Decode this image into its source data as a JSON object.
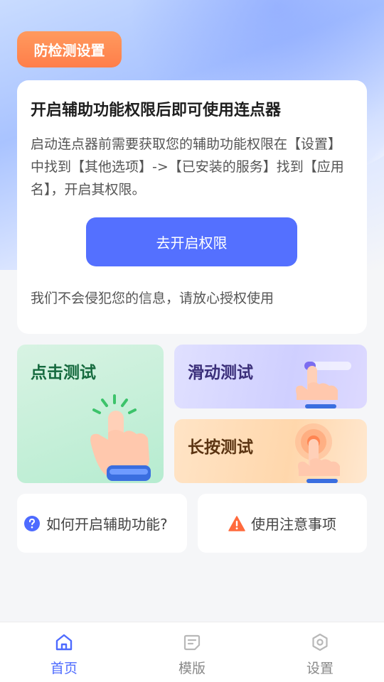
{
  "header": {
    "anti_detect_label": "防检测设置"
  },
  "permission_card": {
    "title": "开启辅助功能权限后即可使用连点器",
    "description": "启动连点器前需要获取您的辅助功能权限在【设置】中找到【其他选项】->【已安装的服务】找到【应用名】，开启其权限。",
    "open_button_label": "去开启权限",
    "note": "我们不会侵犯您的信息，请放心授权使用"
  },
  "tests": {
    "click": "点击测试",
    "slide": "滑动测试",
    "long_press": "长按测试"
  },
  "help": {
    "how_to_enable": "如何开启辅助功能?",
    "notes": "使用注意事项"
  },
  "tabbar": {
    "items": [
      {
        "label": "首页",
        "icon": "home-icon",
        "active": true
      },
      {
        "label": "模版",
        "icon": "template-icon",
        "active": false
      },
      {
        "label": "设置",
        "icon": "settings-icon",
        "active": false
      }
    ]
  },
  "colors": {
    "accent": "#5470ff",
    "anti_detect_bg": "#ff8a52",
    "warning": "#ff6a3d"
  }
}
